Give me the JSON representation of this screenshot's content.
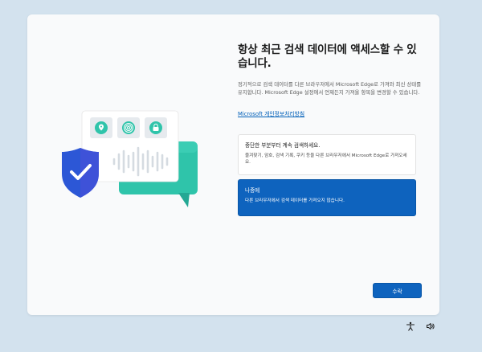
{
  "page": {
    "title": "항상 최근 검색 데이터에 액세스할 수 있습니다.",
    "description": "정기적으로 검색 데이터를 다른 브라우저에서 Microsoft Edge로 가져와 최신 상태를 유지합니다. Microsoft Edge 설정에서 언제든지 가져올 항목을 변경할 수 있습니다.",
    "privacy_link": "Microsoft 개인정보처리방침"
  },
  "options": [
    {
      "title": "중단한 부분부터 계속 검색하세요.",
      "description": "즐겨찾기, 암호, 검색 기록, 쿠키 등을 다른 브라우저에서 Microsoft Edge로 가져오세요.",
      "selected": false
    },
    {
      "title": "나중에",
      "description": "다른 브라우저에서 검색 데이터를 가져오지 않습니다.",
      "selected": true
    }
  ],
  "accept_button": "수락",
  "illustration_icons": [
    "location-pin-icon",
    "fingerprint-icon",
    "lock-icon",
    "shield-check-icon",
    "chat-bubble-icon",
    "audio-waveform-icon"
  ],
  "taskbar_icons": [
    "accessibility-icon",
    "volume-icon"
  ],
  "colors": {
    "background": "#d3e2ee",
    "accent_blue": "#0e63be",
    "link": "#005fb8",
    "teal": "#2fc4aa",
    "shield": "#2c57d6"
  }
}
